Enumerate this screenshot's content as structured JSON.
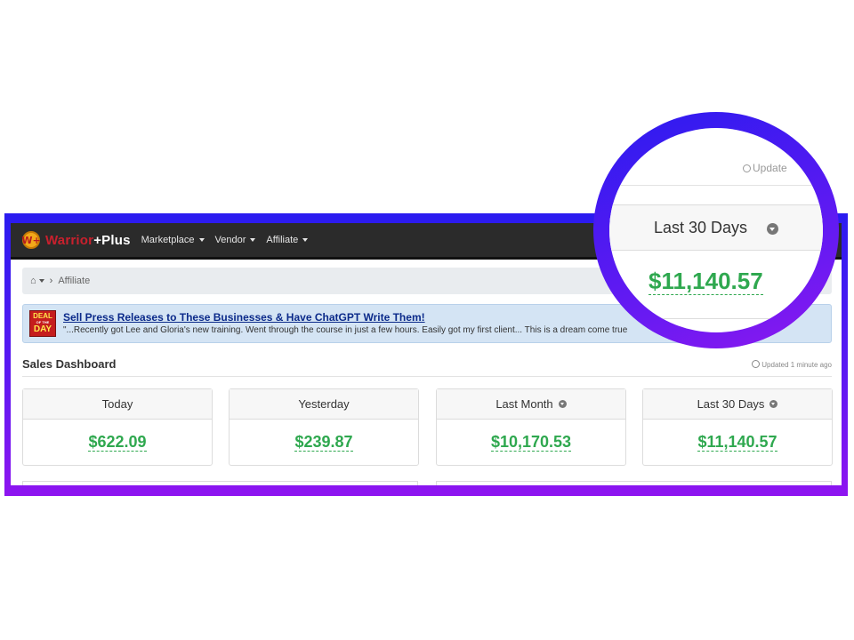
{
  "app": {
    "brand_part1": "Warrior",
    "brand_part2": "+Plus",
    "logo_letter": "W+"
  },
  "nav": {
    "items": [
      "Marketplace",
      "Vendor",
      "Affiliate"
    ]
  },
  "breadcrumb": {
    "home_icon": "⌂",
    "separator": "›",
    "current": "Affiliate"
  },
  "deal": {
    "badge_line1": "DEAL",
    "badge_line2": "OF THE",
    "badge_line3": "DAY",
    "title": "Sell Press Releases to These Businesses & Have ChatGPT Write Them!",
    "quote": "\"...Recently got Lee and Gloria's new training. Went through the course in just a few hours. Easily got my first client... This is a dream come true"
  },
  "dashboard": {
    "title": "Sales Dashboard",
    "updated": "Updated 1 minute ago",
    "cards": [
      {
        "label": "Today",
        "amount": "$622.09"
      },
      {
        "label": "Yesterday",
        "amount": "$239.87"
      },
      {
        "label": "Last Month",
        "amount": "$10,170.53"
      },
      {
        "label": "Last 30 Days",
        "amount": "$11,140.57"
      }
    ]
  },
  "zoom": {
    "updated": "Update",
    "label": "Last 30 Days",
    "amount": "$11,140.57"
  },
  "colors": {
    "frame_top": "#2a1bf0",
    "frame_bottom": "#8e15f0",
    "amount_green": "#2fa84f",
    "navbar": "#2b2b2b",
    "brand_red": "#c9202d"
  }
}
